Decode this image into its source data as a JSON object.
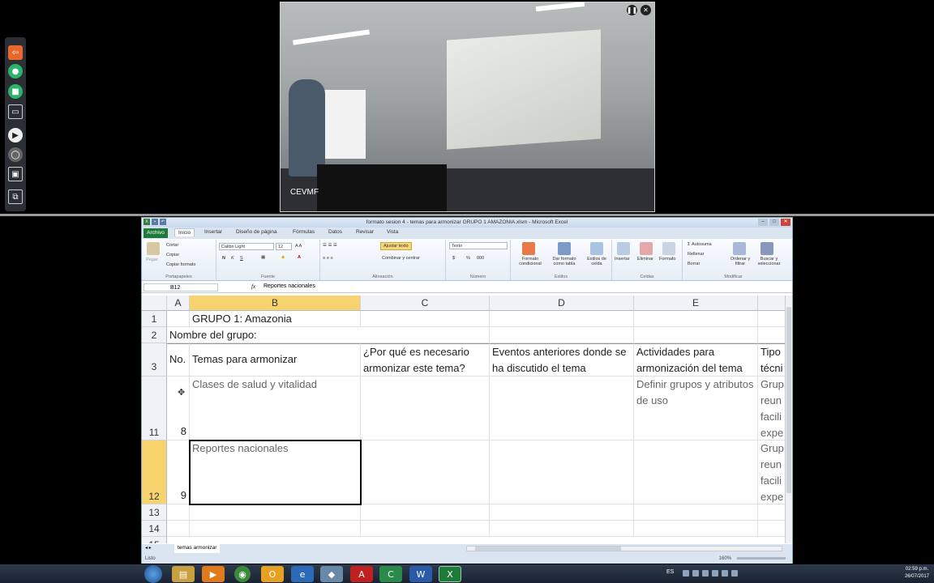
{
  "webcam": {
    "label": "CEVMF",
    "pause_icon": "pause-icon",
    "close_icon": "close-icon"
  },
  "side_toolbar": {
    "icons": [
      "share-icon",
      "microphone-icon",
      "camera-icon",
      "screen-icon",
      "play-icon",
      "mouse-icon",
      "presentation-icon",
      "copy-icon"
    ],
    "colors": {
      "share": "#e8672a",
      "mic": "#2ab36a",
      "cam": "#2ab36a"
    }
  },
  "excel": {
    "title": "formato sesion 4 - temas para armonizar GRUPO 1 AMAZONIA.xlsm - Microsoft Excel",
    "tabs": [
      "Archivo",
      "Inicio",
      "Insertar",
      "Diseño de página",
      "Fórmulas",
      "Datos",
      "Revisar",
      "Vista"
    ],
    "active_tab": "Inicio",
    "ribbon": {
      "clipboard": {
        "paste": "Pegar",
        "cut": "Cortar",
        "copy": "Copiar",
        "format_painter": "Copiar formato",
        "label": "Portapapeles"
      },
      "font": {
        "name": "Calibri Light",
        "size": "12",
        "bold": "N",
        "italic": "K",
        "underline": "S",
        "label": "Fuente"
      },
      "alignment": {
        "wrap": "Ajustar texto",
        "merge": "Combinar y centrar",
        "label": "Alineación"
      },
      "number": {
        "format": "Texto",
        "currency": "$",
        "percent": "%",
        "thousands": "000",
        "label": "Número"
      },
      "styles": {
        "conditional": "Formato condicional",
        "as_table": "Dar formato como tabla",
        "cell_styles": "Estilos de celda",
        "label": "Estilos"
      },
      "cells": {
        "insert": "Insertar",
        "delete": "Eliminar",
        "format": "Formato",
        "label": "Celdas"
      },
      "editing": {
        "autosum": "Autosuma",
        "fill": "Rellenar",
        "clear": "Borrar",
        "sort": "Ordenar y filtrar",
        "find": "Buscar y seleccionar",
        "label": "Modificar"
      }
    },
    "name_box": "B12",
    "fx": "fx",
    "formula": "Reportes nacionales",
    "columns": [
      "A",
      "B",
      "C",
      "D",
      "E"
    ],
    "rows": {
      "r1": {
        "num": "1",
        "b": "GRUPO 1: Amazonia"
      },
      "r2": {
        "num": "2",
        "a": "Nombre del grupo:"
      },
      "r3": {
        "num": "3",
        "a": "No.",
        "b": "Temas para armonizar",
        "c": "¿Por qué es necesario armonizar este tema?",
        "d": "Eventos anteriores donde se ha discutido el tema",
        "e": "Actividades para armonización del tema",
        "f": "Tipo técni"
      },
      "r11": {
        "num": "11",
        "a": "8",
        "b": "Clases de salud y vitalidad",
        "e": "Definir grupos y atributos de uso",
        "f": "Grup reun facili expe"
      },
      "r12": {
        "num": "12",
        "a": "9",
        "b": "Reportes nacionales",
        "f": "Grup reun facili expe"
      },
      "r13": {
        "num": "13"
      },
      "r14": {
        "num": "14"
      },
      "r15": {
        "num": "15"
      }
    },
    "sheet_tab": "temas armonizar",
    "status": "Listo",
    "zoom": "160%"
  },
  "taskbar": {
    "apps": [
      "explorer-icon",
      "media-player-icon",
      "chrome-icon",
      "outlook-icon",
      "ie-icon",
      "app-icon",
      "acrobat-icon",
      "camtasia-icon",
      "word-icon",
      "excel-icon"
    ],
    "language": "ES",
    "time": "02:59 p.m.",
    "date": "26/07/2017"
  }
}
